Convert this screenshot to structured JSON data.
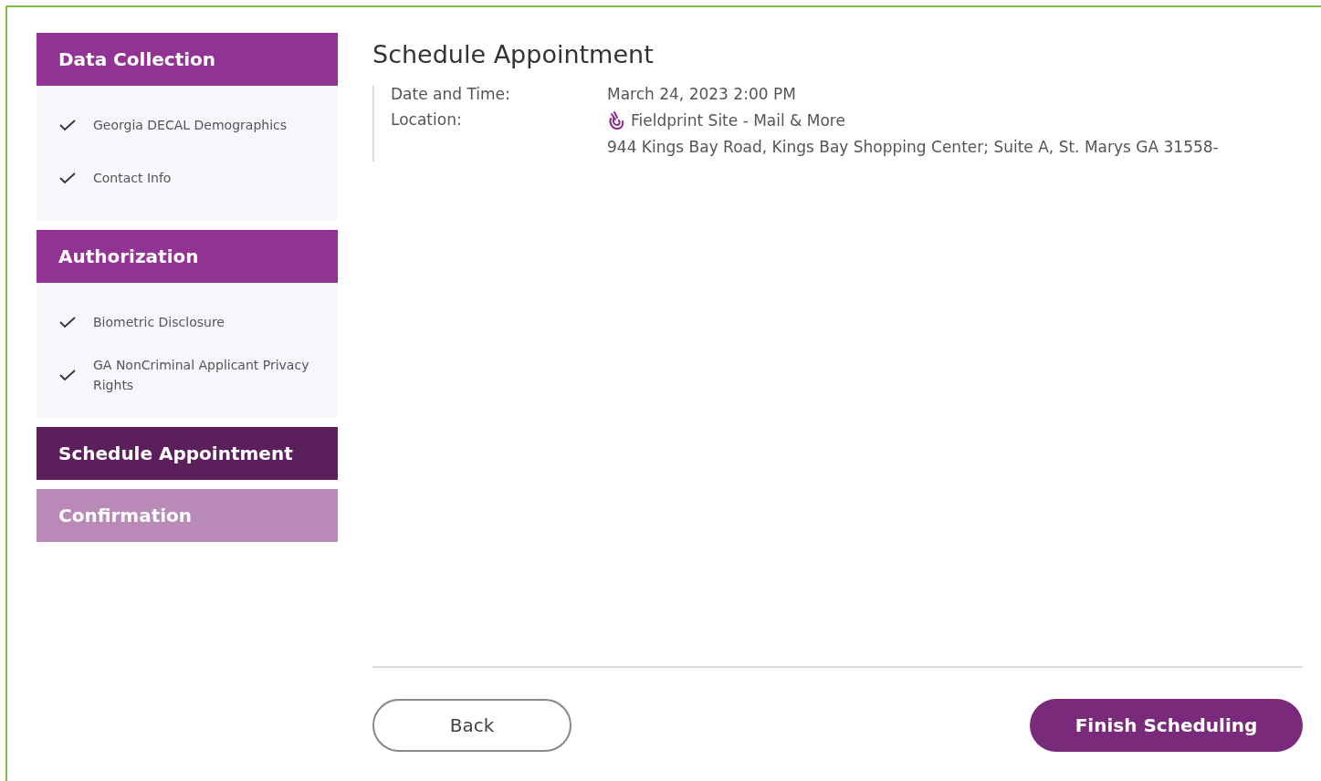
{
  "steps": [
    {
      "title": "Data Collection",
      "kind": "complete",
      "items": [
        {
          "label": "Georgia DECAL Demographics",
          "checked": true
        },
        {
          "label": "Contact Info",
          "checked": true
        }
      ]
    },
    {
      "title": "Authorization",
      "kind": "complete",
      "items": [
        {
          "label": "Biometric Disclosure",
          "checked": true
        },
        {
          "label": "GA NonCriminal Applicant Privacy Rights",
          "checked": true
        }
      ]
    },
    {
      "title": "Schedule Appointment",
      "kind": "current"
    },
    {
      "title": "Confirmation",
      "kind": "pending"
    }
  ],
  "main": {
    "title": "Schedule Appointment",
    "details": [
      {
        "label": "Date and Time:",
        "value": "March 24, 2023 2:00 PM"
      },
      {
        "label": "Location:",
        "site": "Fieldprint Site - Mail & More",
        "address": "944 Kings Bay Road, Kings Bay Shopping Center; Suite A, St. Marys GA 31558-"
      }
    ]
  },
  "buttons": {
    "back": "Back",
    "finish": "Finish Scheduling"
  }
}
